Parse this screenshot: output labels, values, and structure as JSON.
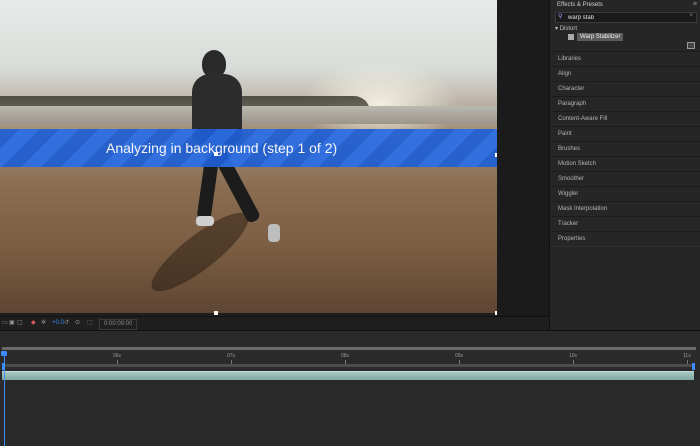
{
  "viewer": {
    "banner_text": "Analyzing in background (step 1 of 2)"
  },
  "panel": {
    "title": "Effects & Presets",
    "search_value": "warp stab",
    "category": "Distort",
    "effect": "Warp Stabilizer",
    "sections": [
      "Libraries",
      "Align",
      "Character",
      "Paragraph",
      "Content-Aware Fill",
      "Paint",
      "Brushes",
      "Motion Sketch",
      "Smoother",
      "Wiggler",
      "Mask Interpolation",
      "Tracker",
      "Properties"
    ]
  },
  "toolbar": {
    "exposure": "+0.0",
    "timecode": "0:00:09:00"
  },
  "timeline": {
    "ticks": [
      "06s",
      "07s",
      "08s",
      "09s",
      "10s",
      "11s"
    ]
  },
  "colors": {
    "accent": "#3b8cff",
    "banner": "#1f5fd4",
    "layer_bar": "#9fc0ba"
  }
}
